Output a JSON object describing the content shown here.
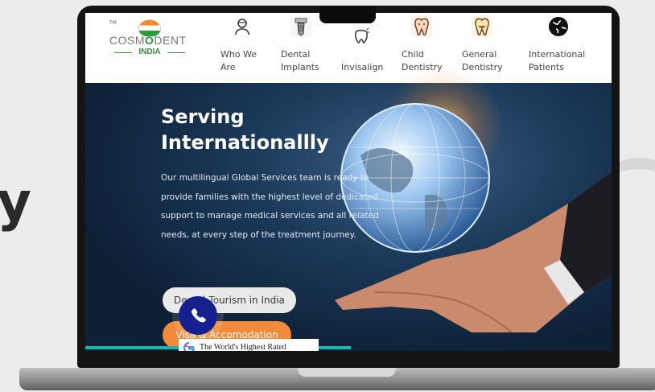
{
  "logo": {
    "tm": "TM",
    "word_left": "COSM",
    "word_o": "O",
    "word_right": "DENT",
    "sub": "INDIA"
  },
  "nav": [
    {
      "label": "Who We\nAre",
      "icon": "dentist-icon"
    },
    {
      "label": "Dental\nImplants",
      "icon": "dental-implant-icon"
    },
    {
      "label": "Invisalign",
      "icon": "invisalign-icon"
    },
    {
      "label": "Child\nDentistry",
      "icon": "child-tooth-icon"
    },
    {
      "label": "General\nDentistry",
      "icon": "smiling-tooth-icon"
    },
    {
      "label": "International\nPatients",
      "icon": "globe-icon"
    }
  ],
  "hero": {
    "title": "Serving\nInternationallly",
    "text": "Our multilingual Global Services team is ready to provide families with the highest level of dedicated support to manage medical services and all related needs, at every step of the treatment journey.",
    "btn_tourism": "Dental Tourism in India",
    "btn_accommodation": "Visa & Accomodation",
    "review": "The World's Highest Rated"
  },
  "colors": {
    "orange": "#f28a3a",
    "call": "#15218e",
    "teal": "#1cb6b0",
    "green": "#3a8c3f"
  }
}
